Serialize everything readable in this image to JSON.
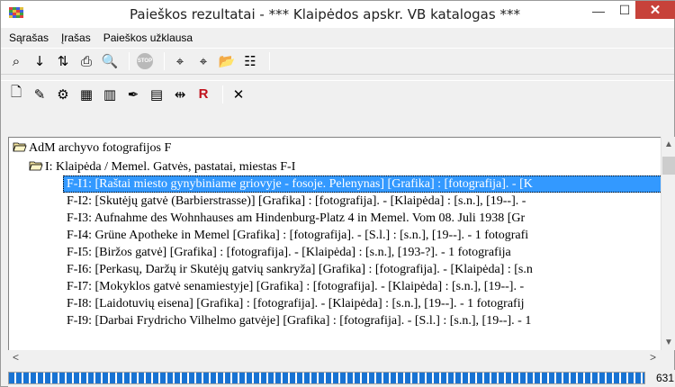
{
  "window": {
    "title": "Paieškos rezultatai - *** Klaipėdos apskr. VB katalogas ***",
    "minimize": "—",
    "maximize": "☐",
    "close": "✕"
  },
  "menu": [
    {
      "label": "Sąrašas"
    },
    {
      "label": "Įrašas"
    },
    {
      "label": "Paieškos užklausa"
    }
  ],
  "toolbar1": [
    {
      "name": "binoculars-icon",
      "glyph": "⌕"
    },
    {
      "name": "sort-az-icon",
      "glyph": "↓"
    },
    {
      "name": "sort-numeric-icon",
      "glyph": "⇅"
    },
    {
      "name": "print-icon",
      "glyph": "⎙"
    },
    {
      "name": "print-preview-icon",
      "glyph": "🔍"
    },
    {
      "name": "stop-icon",
      "glyph": "STOP"
    },
    {
      "name": "search-records-icon",
      "glyph": "⌖"
    },
    {
      "name": "search-next-icon",
      "glyph": "⌖"
    },
    {
      "name": "open-folder-icon",
      "glyph": "📂"
    },
    {
      "name": "tree-view-icon",
      "glyph": "☷"
    }
  ],
  "toolbar2": [
    {
      "name": "new-document-icon",
      "glyph": "🗋"
    },
    {
      "name": "edit-record-icon",
      "glyph": "✎"
    },
    {
      "name": "tools-icon",
      "glyph": "⚙"
    },
    {
      "name": "calculator-icon",
      "glyph": "▦"
    },
    {
      "name": "barcode-icon",
      "glyph": "▥"
    },
    {
      "name": "pen-icon",
      "glyph": "✒"
    },
    {
      "name": "card-icon",
      "glyph": "▤"
    },
    {
      "name": "compare-icon",
      "glyph": "⇹"
    },
    {
      "name": "marc-record-icon",
      "glyph": "R"
    },
    {
      "name": "delete-icon",
      "glyph": "✕"
    }
  ],
  "tree": {
    "root": "AdM archyvo fotografijos F",
    "group": "I: Klaipėda / Memel. Gatvės, pastatai, miestas F-I",
    "items": [
      "F-I1: [Raštai miesto gynybiniame griovyje - fosoje. Pelenynas] [Grafika] : [fotografija]. - [K",
      "F-I2: [Skutėjų gatvė (Barbierstrasse)] [Grafika] : [fotografija]. - [Klaipėda] : [s.n.], [19--]. -",
      "F-I3: Aufnahme des Wohnhauses am Hindenburg-Platz 4 in Memel. Vom 08. Juli 1938 [Gr",
      "F-I4: Grüne Apotheke in Memel [Grafika] : [fotografija]. - [S.l.] : [s.n.], [19--]. - 1 fotografi",
      "F-I5: [Biržos gatvė] [Grafika] : [fotografija]. - [Klaipėda] : [s.n.], [193-?]. - 1 fotografija",
      "F-I6: [Perkasų, Daržų ir Skutėjų gatvių sankryža] [Grafika] : [fotografija]. - [Klaipėda] : [s.n",
      "F-I7: [Mokyklos gatvė senamiestyje] [Grafika] : [fotografija]. - [Klaipėda] : [s.n.], [19--]. -",
      "F-I8: [Laidotuvių eisena] [Grafika] : [fotografija]. - [Klaipėda] : [s.n.], [19--]. - 1 fotografij",
      "F-I9: [Darbai Frydricho Vilhelmo gatvėje] [Grafika] : [fotografija]. - [S.l.] : [s.n.], [19--]. - 1"
    ],
    "selected_index": 0
  },
  "status": {
    "count": "631",
    "progress": 1.0
  },
  "colors": {
    "selection": "#3399ff",
    "close_button": "#c7423a",
    "progress": "#1873d3"
  }
}
